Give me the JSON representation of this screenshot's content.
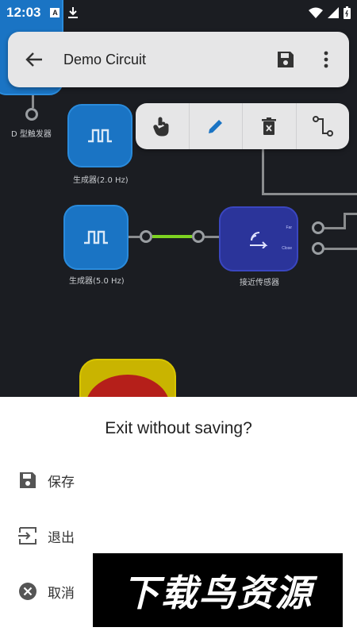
{
  "status_bar": {
    "time": "12:03"
  },
  "app_bar": {
    "title": "Demo Circuit"
  },
  "canvas": {
    "flipflop_label": "D 型触发器",
    "generator1_label": "生成器(2.0 Hz)",
    "generator2_label": "生成器(5.0 Hz)",
    "proximity_label": "接近传感器",
    "proximity_out_top": "Far",
    "proximity_out_bottom": "Close"
  },
  "dialog": {
    "title": "Exit without saving?",
    "items": [
      {
        "label": "保存",
        "icon": "save-icon"
      },
      {
        "label": "退出",
        "icon": "exit-icon"
      },
      {
        "label": "取消",
        "icon": "cancel-icon"
      }
    ]
  },
  "watermark": {
    "text": "下载鸟资源"
  }
}
